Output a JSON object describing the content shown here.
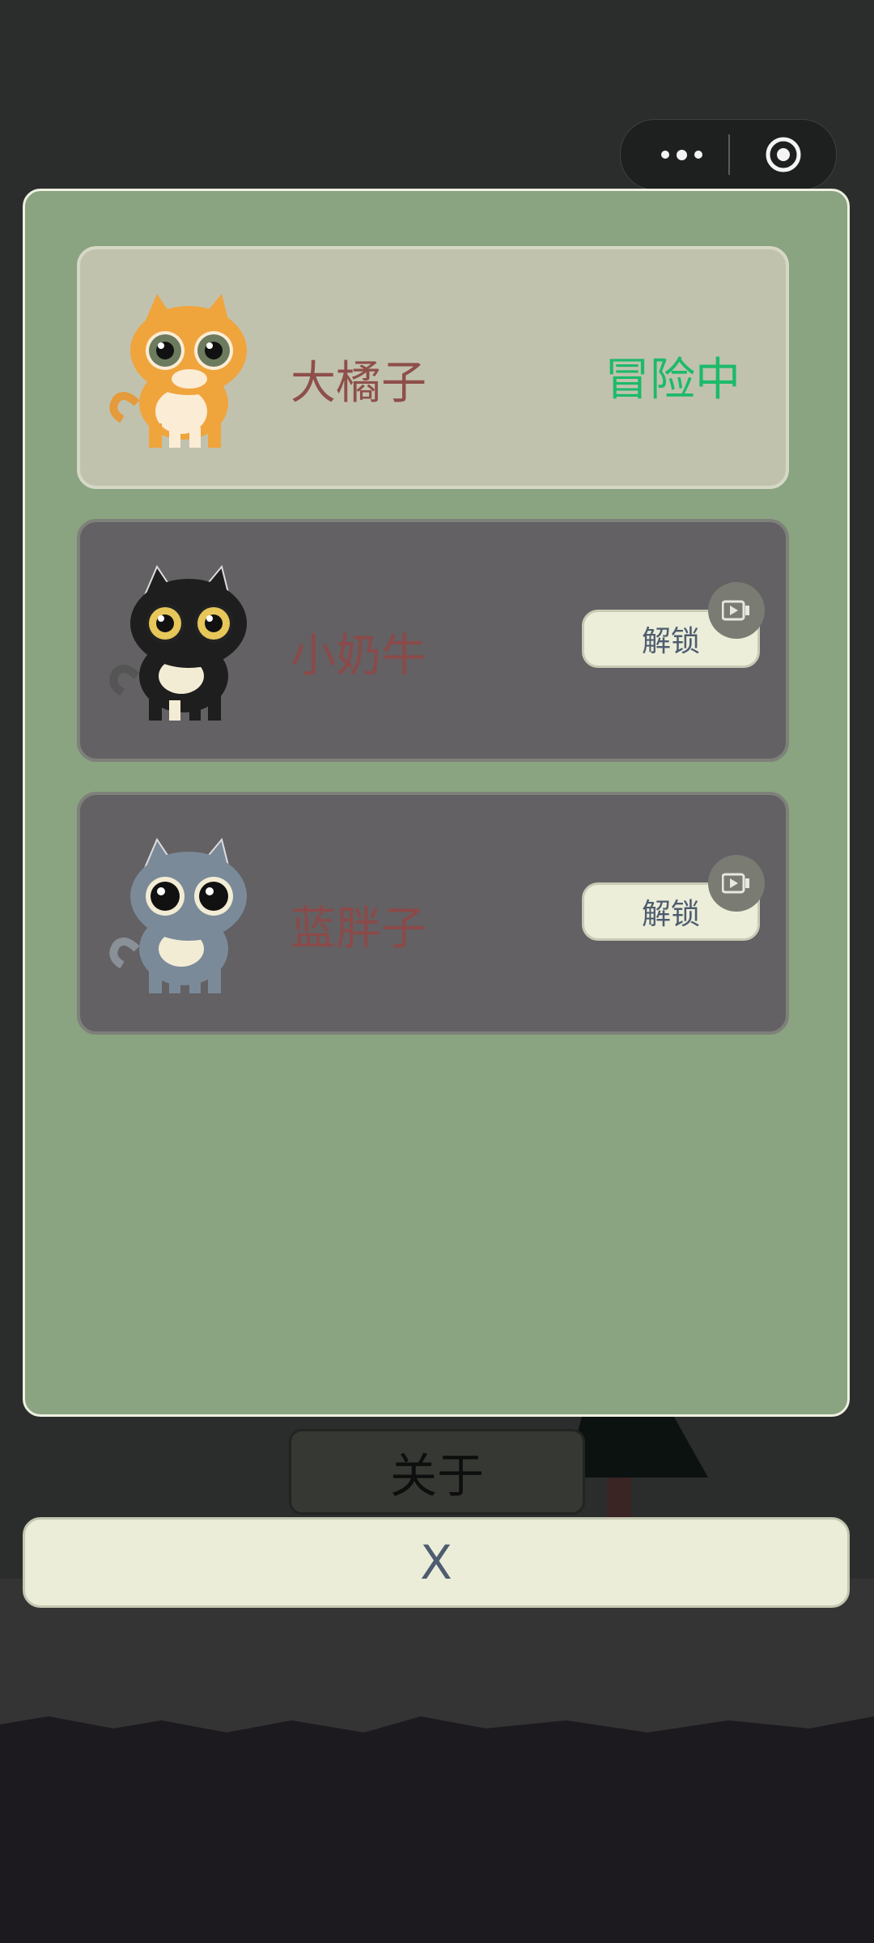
{
  "colors": {
    "panel_bg": "#8aa381",
    "active_card_bg": "#c1c2ae",
    "locked_card_bg": "#636163",
    "status_green": "#1cba6a",
    "name_red": "#8e4f4a",
    "button_bg": "#ebedd8",
    "button_text": "#4e5c70"
  },
  "capsule": {
    "more_icon": "more-dots-icon",
    "close_icon": "target-circle-icon"
  },
  "cats": [
    {
      "name": "大橘子",
      "status": "冒险中",
      "color": "orange",
      "locked": false
    },
    {
      "name": "小奶牛",
      "unlock_label": "解锁",
      "color": "black-white",
      "locked": true,
      "badge_icon": "video-icon"
    },
    {
      "name": "蓝胖子",
      "unlock_label": "解锁",
      "color": "blue-gray",
      "locked": true,
      "badge_icon": "video-icon"
    }
  ],
  "about_label": "关于",
  "close_label": "X"
}
